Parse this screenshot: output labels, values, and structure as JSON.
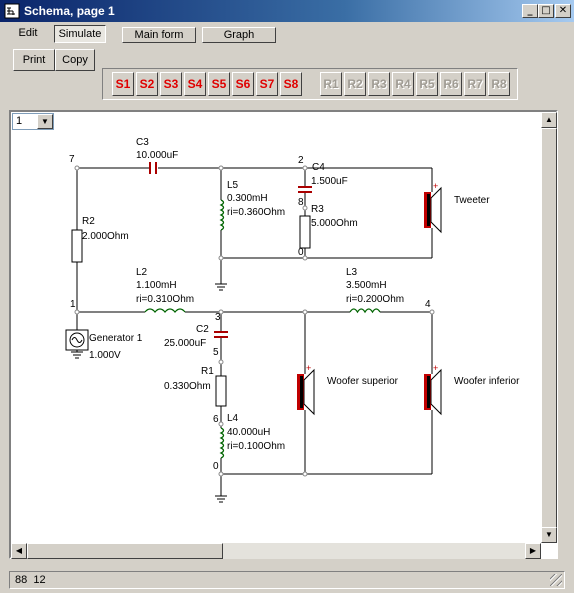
{
  "window": {
    "title": "Schema, page 1",
    "minimize_glyph": "_",
    "maximize_glyph": "□",
    "close_glyph": "✕"
  },
  "menu": {
    "edit": "Edit",
    "simulate": "Simulate",
    "main_form": "Main form",
    "graph": "Graph"
  },
  "toolbar": {
    "print": "Print",
    "copy": "Copy",
    "s_buttons": [
      "S1",
      "S2",
      "S3",
      "S4",
      "S5",
      "S6",
      "S7",
      "S8"
    ],
    "r_buttons": [
      "R1",
      "R2",
      "R3",
      "R4",
      "R5",
      "R6",
      "R7",
      "R8"
    ],
    "accent_color": "#e00000",
    "disabled_color": "#a09c94"
  },
  "page_select": {
    "value": "1"
  },
  "schematic": {
    "nodes": {
      "n7": "7",
      "n2": "2",
      "n8": "8",
      "n0a": "0",
      "n1": "1",
      "n3": "3",
      "n4": "4",
      "n5": "5",
      "n6": "6",
      "n0b": "0"
    },
    "c3": {
      "name": "C3",
      "value": "10.000uF"
    },
    "c4": {
      "name": "C4",
      "value": "1.500uF"
    },
    "l5": {
      "name": "L5",
      "value": "0.300mH",
      "ri": "ri=0.360Ohm"
    },
    "r3": {
      "name": "R3",
      "value": "5.000Ohm"
    },
    "r2": {
      "name": "R2",
      "value": "2.000Ohm"
    },
    "l2": {
      "name": "L2",
      "value": "1.100mH",
      "ri": "ri=0.310Ohm"
    },
    "l3": {
      "name": "L3",
      "value": "3.500mH",
      "ri": "ri=0.200Ohm"
    },
    "c2": {
      "name": "C2",
      "value": "25.000uF"
    },
    "r1": {
      "name": "R1",
      "value": "0.330Ohm"
    },
    "l4": {
      "name": "L4",
      "value": "40.000uH",
      "ri": "ri=0.100Ohm"
    },
    "generator": {
      "name": "Generator 1",
      "value": "1.000V"
    },
    "tweeter": "Tweeter",
    "woofer_superior": "Woofer superior",
    "woofer_inferior": "Woofer inferior",
    "plus_sign": "+"
  },
  "status": {
    "text": "88  12"
  }
}
